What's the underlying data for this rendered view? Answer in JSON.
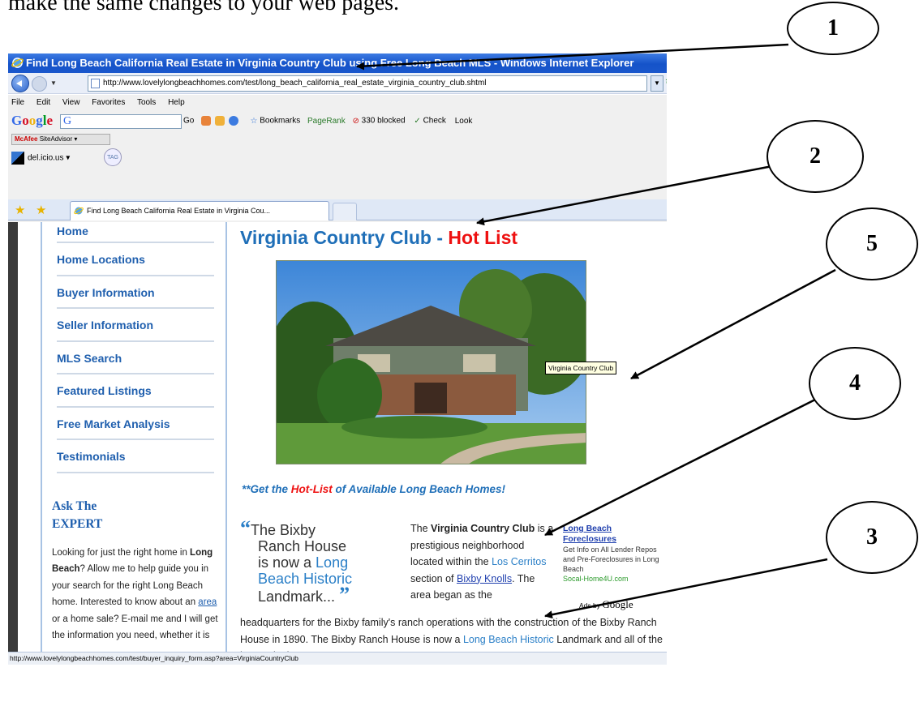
{
  "doc": {
    "text_line": "make the same changes to your web pages."
  },
  "window": {
    "title": "Find Long Beach California Real Estate in Virginia Country Club using Free Long Beach MLS - Windows Internet Explorer"
  },
  "address_bar": {
    "url": "http://www.lovelylongbeachhomes.com/test/long_beach_california_real_estate_virginia_country_club.shtml"
  },
  "menu": [
    "File",
    "Edit",
    "View",
    "Favorites",
    "Tools",
    "Help"
  ],
  "google_toolbar": {
    "logo": [
      "G",
      "o",
      "o",
      "g",
      "l",
      "e"
    ],
    "search_value": "G",
    "go_label": "Go",
    "bookmarks_label": "Bookmarks",
    "pagerank_label": "PageRank",
    "blocked_label": "330 blocked",
    "check_label": "Check",
    "look_label": "Look"
  },
  "mcafee_label": "SiteAdvisor",
  "mcafee_brand": "McAfee",
  "delicious_label": "del.icio.us",
  "tag_label": "TAG",
  "tab": {
    "title": "Find Long Beach California Real Estate in Virginia Cou..."
  },
  "sidebar": {
    "items": [
      {
        "label": "Home"
      },
      {
        "label": "Home Locations"
      },
      {
        "label": "Buyer Information"
      },
      {
        "label": "Seller Information"
      },
      {
        "label": "MLS Search"
      },
      {
        "label": "Featured Listings"
      },
      {
        "label": "Free Market Analysis"
      },
      {
        "label": "Testimonials"
      }
    ],
    "ask_line1": "Ask The",
    "ask_line2": "EXPERT",
    "ask_p1": "Looking for just the right home in ",
    "ask_bold": "Long Beach",
    "ask_p2": "? Allow me to help guide you in your search for the right Long Beach home. Interested to know about an ",
    "ask_link": "area",
    "ask_p3": " or a home sale? E-mail me and I will get the information you need, whether it is"
  },
  "main": {
    "title_blue": "Virginia Country Club - ",
    "title_red": "Hot List",
    "image_tooltip": "Virginia Country Club",
    "hotlist_prefix": "**Get the ",
    "hotlist_red": "Hot-List",
    "hotlist_suffix": " of Available Long Beach Homes!",
    "quote_open": "“",
    "quote_close": "”",
    "quote_l1": "The Bixby",
    "quote_l2": "Ranch House",
    "quote_l3": "is now a ",
    "quote_l3_blue": "Long",
    "quote_l4_blue": "Beach Historic",
    "quote_l5": "Landmark...",
    "p1_a": "The ",
    "p1_bold": "Virginia Country Club",
    "p1_b": " is a prestigious neighborhood located within the ",
    "p1_link": "Los Cerritos",
    "p1_c": " section of ",
    "p1_link2": "Bixby Knolls",
    "p1_d": ". The area began as the",
    "p2_a": "headquarters for the Bixby family's ranch operations with the construction of the Bixby Ranch House in 1890. The Bixby Ranch House is now a ",
    "p2_link": "Long Beach Historic",
    "p2_b": " Landmark and all of the homes in the"
  },
  "ads": {
    "title": "Long Beach Foreclosures",
    "desc": "Get Info on All Lender Repos and Pre-Foreclosures in Long Beach",
    "url": "Socal-Home4U.com",
    "by_label": "Ads by",
    "by_brand": "Google"
  },
  "statusbar": {
    "text": "http://www.lovelylongbeachhomes.com/test/buyer_inquiry_form.asp?area=VirginiaCountryClub"
  },
  "callouts": [
    {
      "number": "1"
    },
    {
      "number": "2"
    },
    {
      "number": "5"
    },
    {
      "number": "4"
    },
    {
      "number": "3"
    }
  ]
}
